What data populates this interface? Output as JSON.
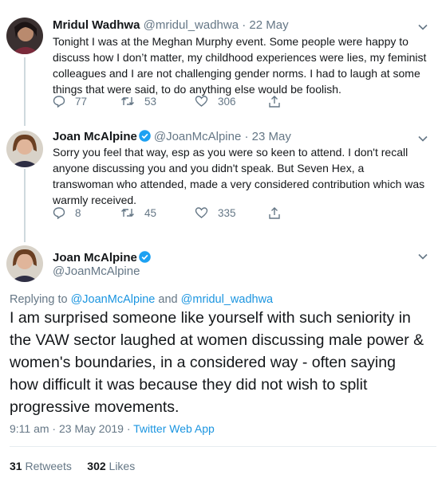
{
  "tweets": [
    {
      "name": "Mridul Wadhwa",
      "handle": "@mridul_wadhwa",
      "date": "· 22 May",
      "text": "Tonight I was at the Meghan Murphy event. Some people  were happy to discuss how I don’t matter, my childhood experiences were lies, my feminist colleagues and I are not challenging gender norms. I had to laugh at some things that were said, to do anything else would be foolish.",
      "replies": "77",
      "retweets": "53",
      "likes": "306"
    },
    {
      "name": "Joan McAlpine",
      "handle": "@JoanMcAlpine",
      "date": "· 23 May",
      "text": "Sorry you feel that way, esp as you were so keen to attend. I don't recall anyone discussing you and you didn't speak. But Seven Hex, a transwoman who attended, made a very considered contribution which was warmly received.",
      "replies": "8",
      "retweets": "45",
      "likes": "335"
    }
  ],
  "main": {
    "name": "Joan McAlpine",
    "handle": "@JoanMcAlpine",
    "replying_prefix": "Replying to ",
    "mention1": "@JoanMcAlpine",
    "replying_and": " and ",
    "mention2": "@mridul_wadhwa",
    "text": "I am surprised someone like yourself with such seniority in the VAW sector laughed at women discussing male power &  women's boundaries, in a considered way - often saying how difficult it was because they did not wish to split progressive movements.",
    "time": "9:11 am · 23 May 2019 · ",
    "source": "Twitter Web App",
    "retweets_count": "31",
    "retweets_label": "Retweets",
    "likes_count": "302",
    "likes_label": "Likes"
  },
  "colors": {
    "link": "#1b95e0",
    "verified": "#1da1f2",
    "muted": "#657786"
  },
  "icons": [
    "reply-icon",
    "retweet-icon",
    "like-icon",
    "share-icon",
    "verified-icon",
    "chevron-down-icon"
  ]
}
